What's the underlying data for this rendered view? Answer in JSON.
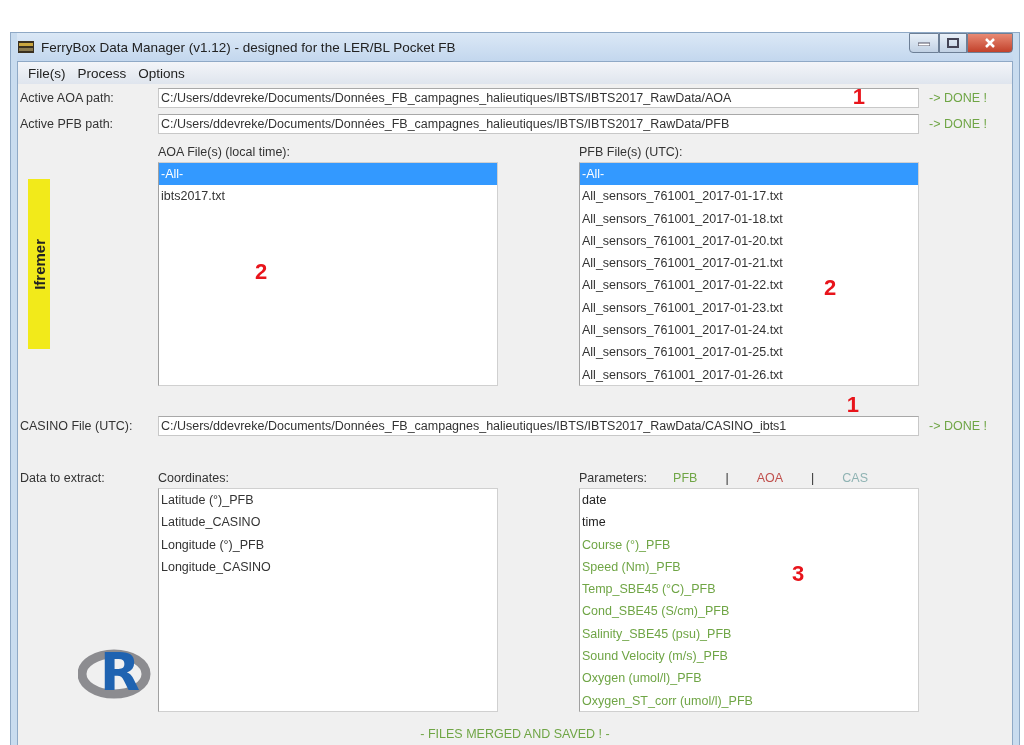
{
  "window": {
    "title": "FerryBox Data Manager (v1.12) - designed for the LER/BL Pocket FB"
  },
  "menu": [
    "File(s)",
    "Process",
    "Options"
  ],
  "paths": [
    {
      "label": "Active AOA path:",
      "value": "C:/Users/ddevreke/Documents/Données_FB_campagnes_halieutiques/IBTS/IBTS2017_RawData/AOA",
      "status": "-> DONE !",
      "annotation": "1"
    },
    {
      "label": "Active PFB path:",
      "value": "C:/Users/ddevreke/Documents/Données_FB_campagnes_halieutiques/IBTS/IBTS2017_RawData/PFB",
      "status": "-> DONE !"
    }
  ],
  "logos": {
    "ifremer": "Ifremer",
    "r": "R"
  },
  "aoa_files": {
    "label": "AOA File(s) (local time):",
    "annotation": "2",
    "items": [
      {
        "name": "-All-",
        "selected": true
      },
      {
        "name": "ibts2017.txt",
        "selected": false
      }
    ]
  },
  "pfb_files": {
    "label": "PFB File(s) (UTC):",
    "annotation": "2",
    "items": [
      {
        "name": "-All-",
        "selected": true
      },
      {
        "name": "All_sensors_761001_2017-01-17.txt",
        "selected": false
      },
      {
        "name": "All_sensors_761001_2017-01-18.txt",
        "selected": false
      },
      {
        "name": "All_sensors_761001_2017-01-20.txt",
        "selected": false
      },
      {
        "name": "All_sensors_761001_2017-01-21.txt",
        "selected": false
      },
      {
        "name": "All_sensors_761001_2017-01-22.txt",
        "selected": false
      },
      {
        "name": "All_sensors_761001_2017-01-23.txt",
        "selected": false
      },
      {
        "name": "All_sensors_761001_2017-01-24.txt",
        "selected": false
      },
      {
        "name": "All_sensors_761001_2017-01-25.txt",
        "selected": false
      },
      {
        "name": "All_sensors_761001_2017-01-26.txt",
        "selected": false
      }
    ]
  },
  "casino": {
    "label": "CASINO File (UTC):",
    "value": "C:/Users/ddevreke/Documents/Données_FB_campagnes_halieutiques/IBTS/IBTS2017_RawData/CASINO_ibts1",
    "status": "-> DONE !",
    "annotation": "1"
  },
  "extract": {
    "label": "Data to extract:",
    "coordinates": {
      "label": "Coordinates:",
      "items": [
        "Latitude (°)_PFB",
        "Latitude_CASINO",
        "Longitude (°)_PFB",
        "Longitude_CASINO"
      ]
    },
    "parameters": {
      "label": "Parameters:",
      "annotation": "3",
      "legend_separator": "|",
      "legend": [
        {
          "label": "PFB",
          "color": "#6fa545"
        },
        {
          "label": "AOA",
          "color": "#c0504d"
        },
        {
          "label": "CAS",
          "color": "#8fb3b3"
        }
      ],
      "items": [
        {
          "name": "date",
          "color": "#222222"
        },
        {
          "name": "time",
          "color": "#222222"
        },
        {
          "name": "Course (°)_PFB",
          "color": "#6fa545"
        },
        {
          "name": "Speed (Nm)_PFB",
          "color": "#6fa545"
        },
        {
          "name": "Temp_SBE45 (°C)_PFB",
          "color": "#6fa545"
        },
        {
          "name": "Cond_SBE45 (S/cm)_PFB",
          "color": "#6fa545"
        },
        {
          "name": "Salinity_SBE45 (psu)_PFB",
          "color": "#6fa545"
        },
        {
          "name": "Sound Velocity (m/s)_PFB",
          "color": "#6fa545"
        },
        {
          "name": "Oxygen (umol/l)_PFB",
          "color": "#6fa545"
        },
        {
          "name": "Oxygen_ST_corr (umol/l)_PFB",
          "color": "#6fa545"
        }
      ]
    }
  },
  "status": "- FILES MERGED AND SAVED ! -"
}
